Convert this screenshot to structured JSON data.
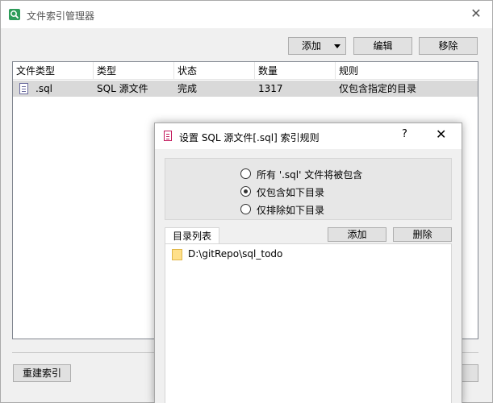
{
  "window": {
    "title": "文件索引管理器"
  },
  "toolbar": {
    "add_label": "添加",
    "edit_label": "编辑",
    "remove_label": "移除"
  },
  "table": {
    "headers": [
      "文件类型",
      "类型",
      "状态",
      "数量",
      "规则"
    ],
    "rows": [
      {
        "file_type": ".sql",
        "type": "SQL 源文件",
        "status": "完成",
        "count": "1317",
        "rule": "仅包含指定的目录"
      }
    ]
  },
  "footer": {
    "rebuild_label": "重建索引"
  },
  "dialog": {
    "title": "设置 SQL 源文件[.sql] 索引规则",
    "help": "?",
    "close": "✕",
    "options": [
      {
        "label": "所有 '.sql' 文件将被包含",
        "checked": false
      },
      {
        "label": "仅包含如下目录",
        "checked": true
      },
      {
        "label": "仅排除如下目录",
        "checked": false
      }
    ],
    "tab_label": "目录列表",
    "add_label": "添加",
    "delete_label": "删除",
    "directories": [
      "D:\\gitRepo\\sql_todo"
    ]
  }
}
